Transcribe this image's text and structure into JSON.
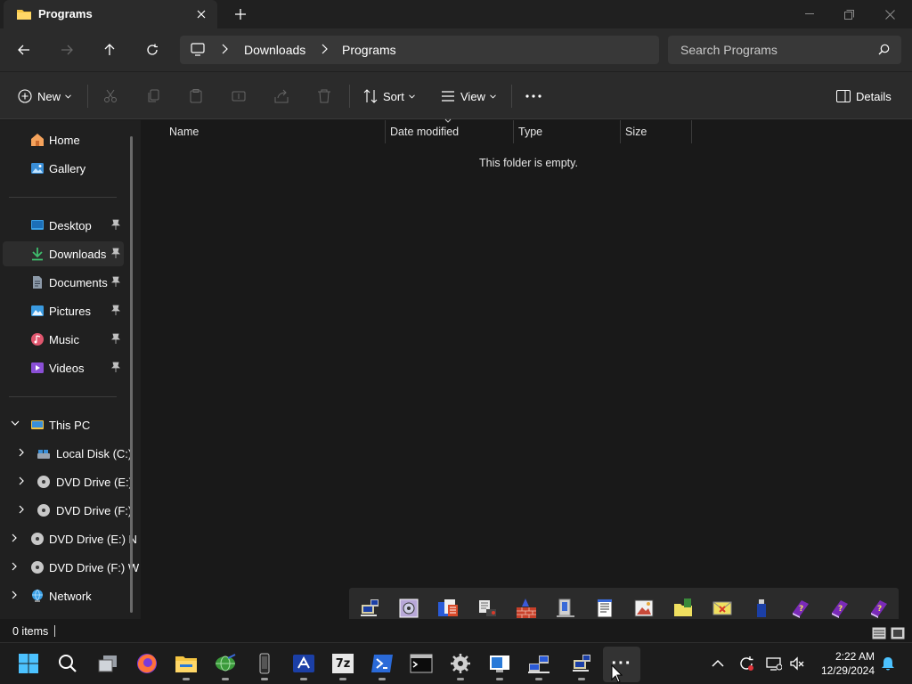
{
  "window": {
    "tab_title": "Programs",
    "new_tab_symbol": "+"
  },
  "address": {
    "breadcrumbs": [
      "Downloads",
      "Programs"
    ],
    "search_placeholder": "Search Programs"
  },
  "commandbar": {
    "new_label": "New",
    "sort_label": "Sort",
    "view_label": "View",
    "details_label": "Details"
  },
  "sidebar": {
    "home": "Home",
    "gallery": "Gallery",
    "desktop": "Desktop",
    "downloads": "Downloads",
    "documents": "Documents",
    "pictures": "Pictures",
    "music": "Music",
    "videos": "Videos",
    "this_pc": "This PC",
    "local_disk": "Local Disk (C:)",
    "dvd_e": "DVD Drive (E:)",
    "dvd_f": "DVD Drive (F:)",
    "dvd_e2": "DVD Drive (E:) N",
    "dvd_f2": "DVD Drive (F:) W",
    "network": "Network",
    "selected": "downloads"
  },
  "content": {
    "columns": [
      "Name",
      "Date modified",
      "Type",
      "Size"
    ],
    "empty_message": "This folder is empty."
  },
  "status": {
    "item_count": "0 items"
  },
  "taskbar": {
    "time": "2:22 AM",
    "date": "12/29/2024",
    "overflow_symbol": "···",
    "sevenzip_label": "7z"
  },
  "colors": {
    "accent": "#4cc2ff",
    "folder": "#f5c542",
    "background": "#191919",
    "panel": "#2b2b2b"
  },
  "icons": {
    "quick_launch": [
      "network-computer-icon",
      "safe-icon",
      "documents-stack-icon",
      "printer-tools-icon",
      "firewall-icon",
      "component-services-icon",
      "notepad-icon",
      "image-icon",
      "folder-tools-icon",
      "mail-icon",
      "usb-drive-icon",
      "help-book-icon",
      "help-book-icon",
      "help-book-icon"
    ]
  }
}
